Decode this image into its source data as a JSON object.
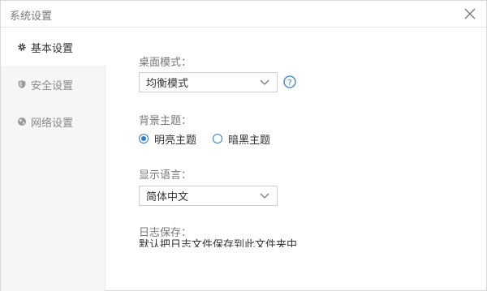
{
  "window": {
    "title": "系统设置"
  },
  "sidebar": {
    "items": [
      {
        "label": "基本设置",
        "icon": "gear-icon",
        "active": true
      },
      {
        "label": "安全设置",
        "icon": "shield-icon",
        "active": false
      },
      {
        "label": "网络设置",
        "icon": "globe-icon",
        "active": false
      }
    ]
  },
  "basic": {
    "desktop_mode_label": "桌面模式：",
    "desktop_mode_value": "均衡模式",
    "theme_label": "背景主题：",
    "theme_options": [
      {
        "label": "明亮主题",
        "checked": true
      },
      {
        "label": "暗黑主题",
        "checked": false
      }
    ],
    "language_label": "显示语言：",
    "language_value": "简体中文",
    "log_label": "日志保存：",
    "log_text_partial": "默认把日志文件保存到此文件夹中"
  },
  "colors": {
    "accent": "#2e7bd6",
    "sidebar_bg": "#f5f6f7"
  }
}
